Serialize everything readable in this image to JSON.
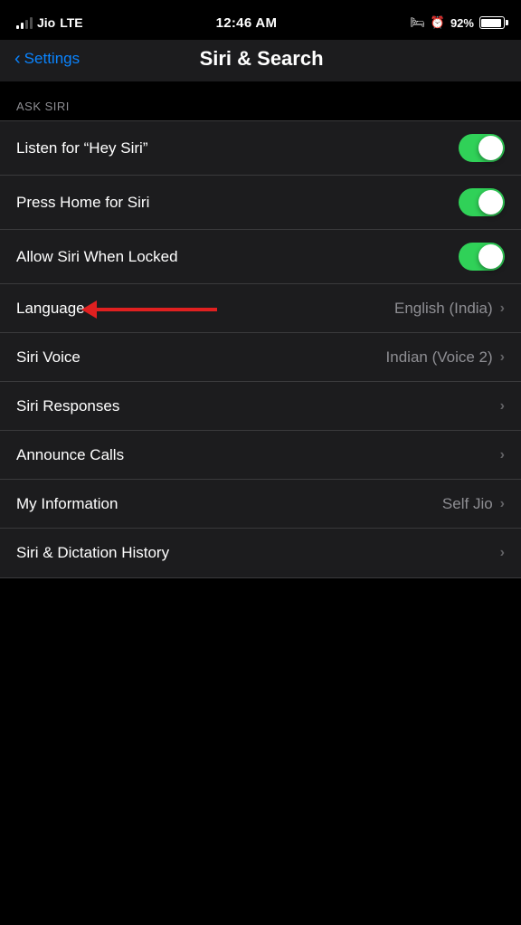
{
  "status_bar": {
    "carrier": "Jio",
    "network": "LTE",
    "time": "12:46 AM",
    "battery_percent": "92%"
  },
  "nav": {
    "back_label": "Settings",
    "title": "Siri & Search"
  },
  "section": {
    "ask_siri_header": "ASK SIRI"
  },
  "rows": [
    {
      "id": "listen-hey-siri",
      "label": "Listen for “Hey Siri”",
      "type": "toggle",
      "value": true
    },
    {
      "id": "press-home-siri",
      "label": "Press Home for Siri",
      "type": "toggle",
      "value": true
    },
    {
      "id": "allow-siri-locked",
      "label": "Allow Siri When Locked",
      "type": "toggle",
      "value": true
    },
    {
      "id": "language",
      "label": "Language",
      "type": "value-chevron",
      "value": "English (India)",
      "has_arrow": true
    },
    {
      "id": "siri-voice",
      "label": "Siri Voice",
      "type": "value-chevron",
      "value": "Indian (Voice 2)"
    },
    {
      "id": "siri-responses",
      "label": "Siri Responses",
      "type": "chevron",
      "value": ""
    },
    {
      "id": "announce-calls",
      "label": "Announce Calls",
      "type": "chevron",
      "value": ""
    },
    {
      "id": "my-information",
      "label": "My Information",
      "type": "value-chevron",
      "value": "Self Jio"
    },
    {
      "id": "siri-dictation-history",
      "label": "Siri & Dictation History",
      "type": "chevron",
      "value": ""
    }
  ],
  "chevron_char": "›",
  "back_chevron_char": "‹"
}
